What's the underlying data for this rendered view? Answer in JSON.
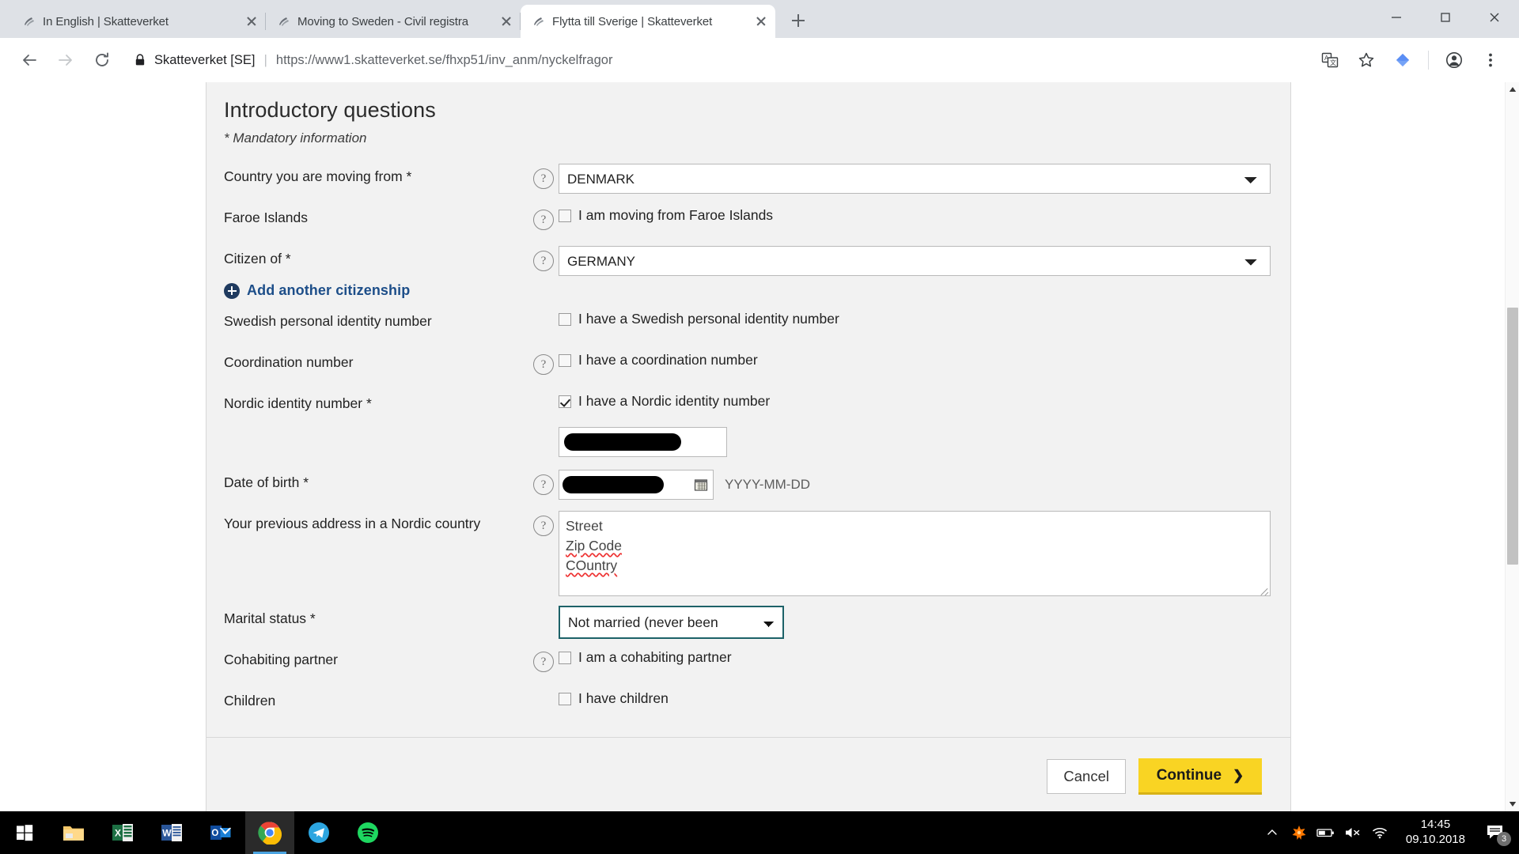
{
  "browser": {
    "tabs": [
      {
        "title": "In English | Skatteverket",
        "active": false,
        "favicon": "skatteverket-icon"
      },
      {
        "title": "Moving to Sweden - Civil registra",
        "active": false,
        "favicon": "skatteverket-icon"
      },
      {
        "title": "Flytta till Sverige | Skatteverket",
        "active": true,
        "favicon": "skatteverket-icon"
      }
    ],
    "new_tab_label": "+",
    "window_controls": [
      "minimize-button",
      "maximize-button",
      "close-button"
    ],
    "nav": {
      "back": "back-arrow-icon",
      "forward": "forward-arrow-icon",
      "reload": "reload-icon"
    },
    "omnibox": {
      "lock": "lock-icon",
      "site_identity": "Skatteverket [SE]",
      "separator": "|",
      "url": "https://www1.skatteverket.se/fhxp51/inv_anm/nyckelfragor"
    },
    "toolbar_icons": [
      "translate-icon",
      "bookmark-star-icon",
      "extension-diamond-icon",
      "profile-avatar-icon",
      "three-dot-menu-icon"
    ]
  },
  "form": {
    "title": "Introductory questions",
    "mandatory_note": "* Mandatory information",
    "rows": {
      "country_from": {
        "label": "Country you are moving from *",
        "help": "?",
        "value": "DENMARK"
      },
      "faroe": {
        "label": "Faroe Islands",
        "help": "?",
        "checkbox_label": "I am moving from Faroe Islands",
        "checked": false
      },
      "citizen_of": {
        "label": "Citizen of *",
        "help": "?",
        "value": "GERMANY"
      },
      "add_citizenship": {
        "link_label": "Add another citizenship",
        "icon": "plus-circle-icon"
      },
      "swedish_pin": {
        "label": "Swedish personal identity number",
        "checkbox_label": "I have a Swedish personal identity number",
        "checked": false
      },
      "coordination": {
        "label": "Coordination number",
        "help": "?",
        "checkbox_label": "I have a coordination number",
        "checked": false
      },
      "nordic_id": {
        "label": "Nordic identity number *",
        "checkbox_label": "I have a Nordic identity number",
        "checked": true,
        "value": "[redacted]"
      },
      "date_of_birth": {
        "label": "Date of birth *",
        "help": "?",
        "value": "[redacted]",
        "calendar_icon": "calendar-icon",
        "format_hint": "YYYY-MM-DD"
      },
      "previous_address": {
        "label": "Your previous address in a Nordic country",
        "help": "?",
        "line1": "Street",
        "line2": "Zip Code",
        "line3": "COuntry"
      },
      "marital_status": {
        "label": "Marital status *",
        "value": "Not married (never been"
      },
      "cohabiting": {
        "label": "Cohabiting partner",
        "help": "?",
        "checkbox_label": "I am a cohabiting partner",
        "checked": false
      },
      "children": {
        "label": "Children",
        "checkbox_label": "I have children",
        "checked": false
      }
    },
    "buttons": {
      "cancel": "Cancel",
      "continue": "Continue",
      "continue_chevron": "❯"
    },
    "colors": {
      "continue_bg": "#f9d423",
      "continue_border": "#d7b216",
      "focus_border": "#1d6268",
      "link": "#1d4e89",
      "panel_bg": "#f2f2f2"
    }
  },
  "taskbar": {
    "apps": [
      {
        "name": "start-button",
        "label": "Start"
      },
      {
        "name": "file-explorer-icon",
        "label": "File Explorer"
      },
      {
        "name": "excel-icon",
        "label": "Excel"
      },
      {
        "name": "word-icon",
        "label": "Word"
      },
      {
        "name": "outlook-icon",
        "label": "Outlook"
      },
      {
        "name": "chrome-icon",
        "label": "Google Chrome"
      },
      {
        "name": "telegram-icon",
        "label": "Telegram"
      },
      {
        "name": "spotify-icon",
        "label": "Spotify"
      }
    ],
    "tray": [
      "show-hidden-icons-chevron",
      "avast-icon",
      "battery-icon",
      "volume-muted-icon",
      "wifi-icon"
    ],
    "clock_time": "14:45",
    "clock_date": "09.10.2018",
    "notification_count": "3"
  }
}
